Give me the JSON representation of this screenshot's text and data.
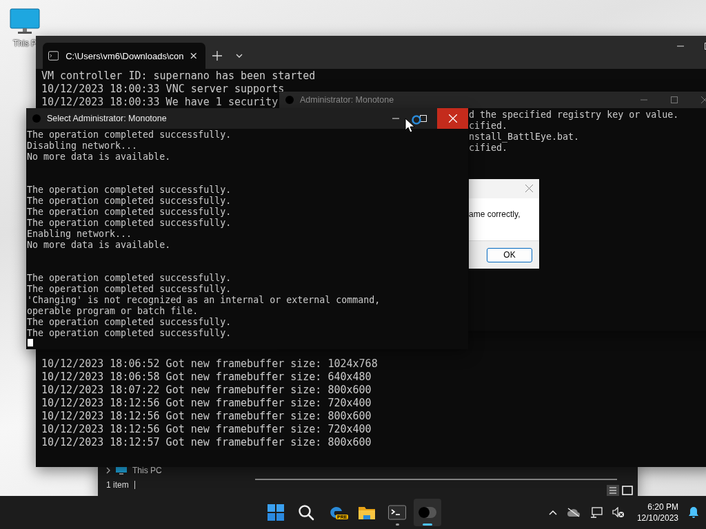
{
  "desktop": {
    "icons": [
      {
        "label": "This P"
      }
    ]
  },
  "explorer": {
    "tree_item": "This PC",
    "status": "1 item"
  },
  "terminal": {
    "tabs": [
      {
        "title": "C:\\Users\\vm6\\Downloads\\con",
        "selected": true
      }
    ],
    "top_lines": [
      "VM controller ID: supernano has been started",
      "10/12/2023 18:00:33 VNC server supports",
      "10/12/2023 18:00:33 We have 1 security"
    ],
    "bottom_lines": [
      "10/12/2023 18:06:52 Got new framebuffer size: 1024x768",
      "10/12/2023 18:06:58 Got new framebuffer size: 640x480",
      "10/12/2023 18:07:22 Got new framebuffer size: 800x600",
      "10/12/2023 18:12:56 Got new framebuffer size: 720x400",
      "10/12/2023 18:12:56 Got new framebuffer size: 800x600",
      "10/12/2023 18:12:56 Got new framebuffer size: 720x400",
      "10/12/2023 18:12:57 Got new framebuffer size: 800x600"
    ]
  },
  "back_console": {
    "title": "Administrator:  Monotone",
    "lines": [
      "d the specified registry key or value.",
      "cified.",
      "nstall_BattlEye.bat.",
      "cified."
    ],
    "dialog": {
      "message": "ame correctly,",
      "button": "OK"
    }
  },
  "front_console": {
    "title": "Select Administrator:  Monotone",
    "blocks": [
      [
        "The operation completed successfully.",
        "Disabling network...",
        "No more data is available."
      ],
      [
        "The operation completed successfully.",
        "The operation completed successfully.",
        "The operation completed successfully.",
        "The operation completed successfully.",
        "Enabling network...",
        "No more data is available."
      ],
      [
        "The operation completed successfully.",
        "The operation completed successfully.",
        "'Changing' is not recognized as an internal or external command,",
        "operable program or batch file.",
        "The operation completed successfully.",
        "The operation completed successfully."
      ]
    ]
  },
  "taskbar": {
    "apps": [
      {
        "kind": "start",
        "running": false,
        "selected": false
      },
      {
        "kind": "search",
        "running": false,
        "selected": false
      },
      {
        "kind": "browser",
        "badge": "PRE",
        "running": false,
        "selected": false
      },
      {
        "kind": "folder",
        "running": false,
        "selected": false
      },
      {
        "kind": "terminal",
        "running": true,
        "selected": false
      },
      {
        "kind": "toggle",
        "running": true,
        "selected": true
      }
    ],
    "clock": {
      "time": "6:20 PM",
      "date": "12/10/2023"
    }
  }
}
